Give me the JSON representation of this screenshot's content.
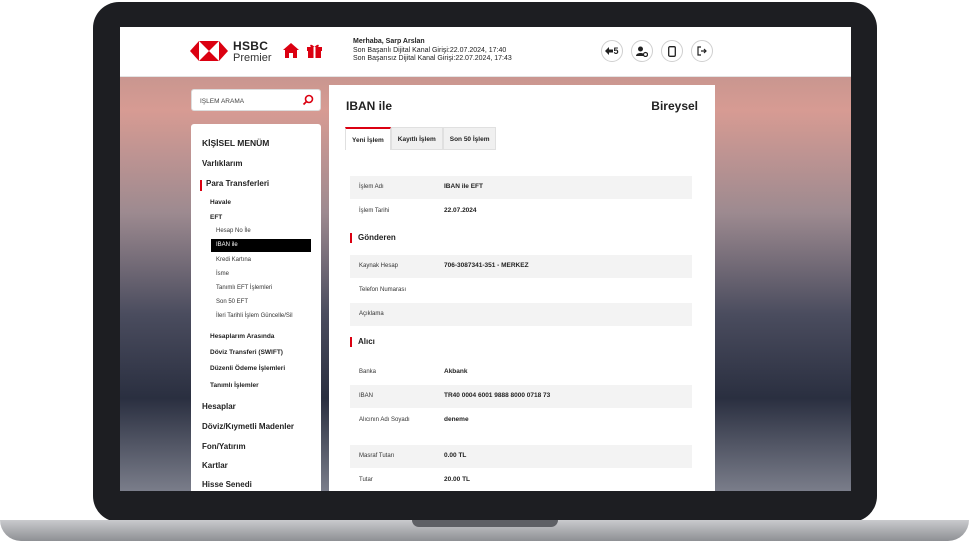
{
  "header": {
    "brand": "HSBC",
    "brand_sub": "Premier",
    "greeting": "Merhaba, Sarp Arslan",
    "last_login_success": "Son Başarılı Dijital Kanal Girişi:22.07.2024, 17:40",
    "last_login_fail": "Son Başarısız Dijital Kanal Girişi:22.07.2024, 17:43",
    "notifications_count": "5"
  },
  "colors": {
    "brand_red": "#db0011"
  },
  "search": {
    "placeholder": "İŞLEM ARAMA"
  },
  "menu": {
    "title": "KİŞİSEL MENÜM",
    "items": [
      "Varlıklarım",
      "Para Transferleri",
      "Havale",
      "EFT",
      "Hesap No İle",
      "IBAN ile",
      "Kredi Kartına",
      "İsme",
      "Tanımlı EFT İşlemleri",
      "Son 50 EFT",
      "İleri Tarihli İşlem Güncelle/Sil",
      "Hesaplarım Arasında",
      "Döviz Transferi (SWIFT)",
      "Düzenli Ödeme İşlemleri",
      "Tanımlı İşlemler",
      "Hesaplar",
      "Döviz/Kıymetli Madenler",
      "Fon/Yatırım",
      "Kartlar",
      "Hisse Senedi"
    ]
  },
  "main": {
    "title": "IBAN ile",
    "segment": "Bireysel",
    "tabs": [
      "Yeni İşlem",
      "Kayıtlı İşlem",
      "Son 50 İşlem"
    ],
    "rows": [
      {
        "label": "İşlem Adı",
        "value": "IBAN ile EFT"
      },
      {
        "label": "İşlem Tarihi",
        "value": "22.07.2024"
      },
      {
        "label": "Kaynak Hesap",
        "value": "706-3087341-351 - MERKEZ"
      },
      {
        "label": "Telefon Numarası",
        "value": ""
      },
      {
        "label": "Açıklama",
        "value": ""
      },
      {
        "label": "Banka",
        "value": "Akbank"
      },
      {
        "label": "IBAN",
        "value": "TR40 0004 6001 9888 8000 0718 73"
      },
      {
        "label": "Alıcının Adı Soyadı",
        "value": "deneme"
      },
      {
        "label": "Masraf Tutarı",
        "value": "0.00 TL"
      },
      {
        "label": "Tutar",
        "value": "20.00 TL"
      }
    ],
    "sections": [
      "Gönderen",
      "Alıcı"
    ]
  }
}
